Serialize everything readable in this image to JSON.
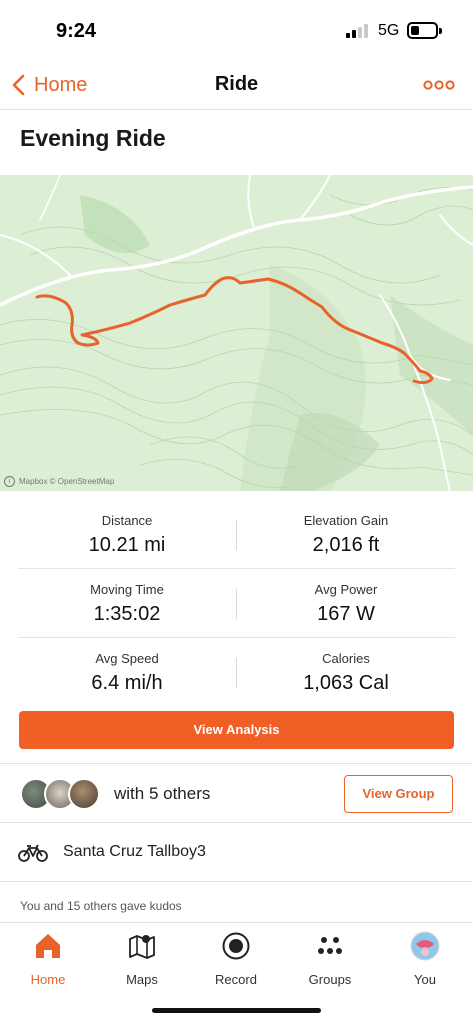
{
  "status_bar": {
    "time": "9:24",
    "network": "5G"
  },
  "header": {
    "back_label": "Home",
    "title": "Ride"
  },
  "activity": {
    "title": "Evening Ride"
  },
  "map": {
    "attribution": "Mapbox © OpenStreetMap"
  },
  "stats": [
    {
      "label": "Distance",
      "value": "10.21 mi"
    },
    {
      "label": "Elevation Gain",
      "value": "2,016 ft"
    },
    {
      "label": "Moving Time",
      "value": "1:35:02"
    },
    {
      "label": "Avg Power",
      "value": "167 W"
    },
    {
      "label": "Avg Speed",
      "value": "6.4 mi/h"
    },
    {
      "label": "Calories",
      "value": "1,063 Cal"
    }
  ],
  "analysis_button": "View Analysis",
  "group": {
    "text": "with 5 others",
    "button": "View Group"
  },
  "gear": {
    "name": "Santa Cruz Tallboy3"
  },
  "kudos": "You and 15 others gave kudos",
  "tabs": [
    {
      "label": "Home",
      "icon": "home-icon"
    },
    {
      "label": "Maps",
      "icon": "maps-icon"
    },
    {
      "label": "Record",
      "icon": "record-icon"
    },
    {
      "label": "Groups",
      "icon": "groups-icon"
    },
    {
      "label": "You",
      "icon": "profile-avatar-icon"
    }
  ],
  "colors": {
    "accent": "#ef5f26",
    "map_bg": "#dceed4",
    "route": "#e8632b"
  }
}
